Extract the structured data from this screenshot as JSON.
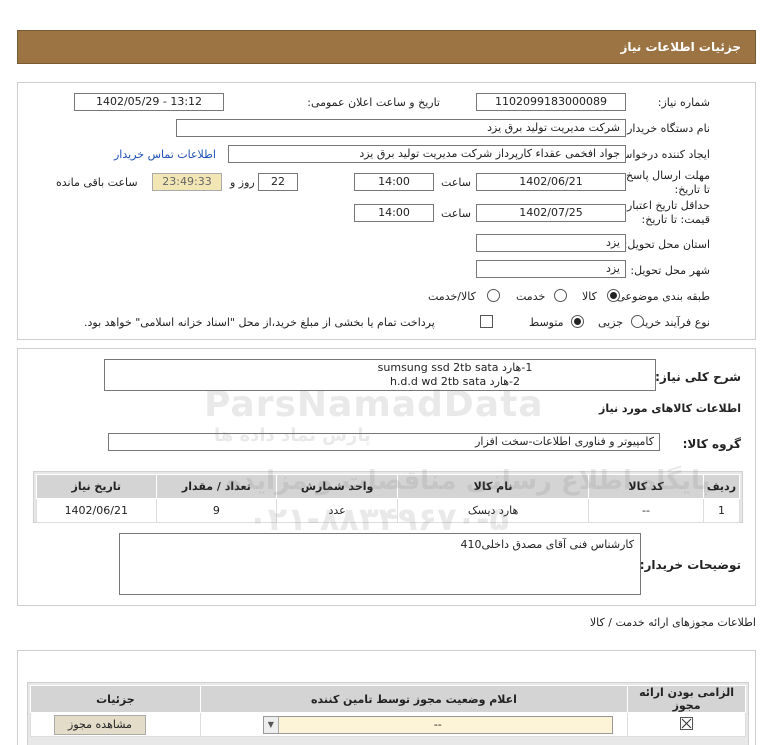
{
  "header": {
    "title": "جزئیات اطلاعات نیاز"
  },
  "form": {
    "need_number_label": "شماره نیاز:",
    "need_number": "1102099183000089",
    "announce_label": "تاریخ و ساعت اعلان عمومی:",
    "announce_value": "1402/05/29 - 13:12",
    "buyer_org_label": "نام دستگاه خریدار:",
    "buyer_org": "شرکت مدیریت تولید برق یزد",
    "creator_label": "ایجاد کننده درخواست:",
    "creator": "جواد افخمی عقداء کارپرداز شرکت مدیریت تولید برق یزد",
    "contact_link": "اطلاعات تماس خریدار",
    "reply_deadline_label": "مهلت ارسال پاسخ: تا تاریخ:",
    "reply_date": "1402/06/21",
    "time_label": "ساعت",
    "reply_time": "14:00",
    "days_value": "22",
    "days_label": "روز و",
    "remaining_time": "23:49:33",
    "remaining_label": "ساعت باقی مانده",
    "validity_label": "حداقل تاریخ اعتبار قیمت: تا تاریخ:",
    "validity_date": "1402/07/25",
    "validity_time_label": "ساعت",
    "validity_time": "14:00",
    "province_label": "استان محل تحویل:",
    "province": "یزد",
    "city_label": "شهر محل تحویل:",
    "city": "یزد",
    "category_label": "طبقه بندی موضوعی:",
    "category_options": [
      "کالا",
      "خدمت",
      "کالا/خدمت"
    ],
    "process_label": "نوع فرآیند خرید :",
    "process_options": [
      "جزیی",
      "متوسط"
    ],
    "payment_note": "پرداخت تمام یا بخشی از مبلغ خرید،از محل \"اسناد خزانه اسلامی\" خواهد بود."
  },
  "details": {
    "general_desc_label": "شرح کلی نیاز:",
    "general_desc_lines": [
      "1-هارد sumsung ssd 2tb sata",
      "2-هارد h.d.d wd 2tb sata"
    ],
    "goods_info_title": "اطلاعات کالاهای مورد نیاز",
    "goods_group_label": "گروه کالا:",
    "goods_group": "کامپیوتر و فناوری اطلاعات-سخت افزار",
    "table_headers": [
      "ردیف",
      "کد کالا",
      "نام کالا",
      "واحد شمارش",
      "تعداد / مقدار",
      "تاریخ نیاز"
    ],
    "table_rows": [
      [
        "1",
        "--",
        "هارد دیسک",
        "عدد",
        "9",
        "1402/06/21"
      ]
    ],
    "buyer_notes_label": "توضیحات خریدار:",
    "buyer_notes": "کارشناس فنی آقای مصدق داخلی410"
  },
  "permits": {
    "title": "اطلاعات مجوزهای ارائه خدمت / کالا",
    "headers": [
      "الزامی بودن ارائه مجوز",
      "اعلام وضعیت مجوز توسط تامین کننده",
      "جزئیات"
    ],
    "status_value": "--",
    "view_button": "مشاهده مجوز"
  },
  "watermark": {
    "brand": "ParsNamadData",
    "persian": "پایگاه اطلاع رسانی مناقصات و مزایده",
    "phone": "۰۲۱-۸۸۳۴۹۶۷۰-۵",
    "fa_brand": "پارس نماد داده ها"
  }
}
